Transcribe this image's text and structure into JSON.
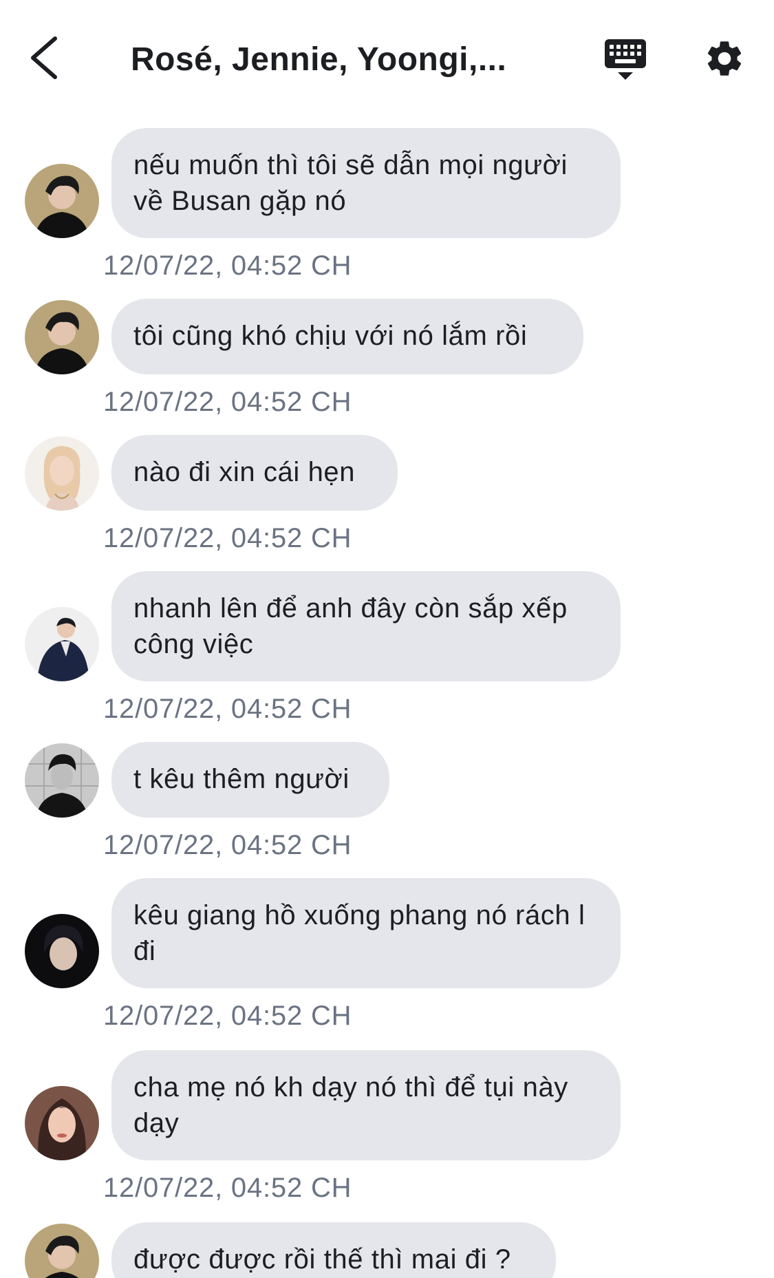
{
  "header": {
    "title": "Rosé, Jennie, Yoongi,...",
    "back_icon": "chevron-left-icon",
    "keyboard_icon": "keyboard-icon",
    "settings_icon": "gear-icon"
  },
  "colors": {
    "bubble": "#e4e6eb",
    "timestamp": "#6a7382",
    "text": "#1c1e21",
    "background": "#ffffff"
  },
  "messages": [
    {
      "text": "nếu muốn thì tôi sẽ dẫn mọi người về Busan gặp nó",
      "time": "12/07/22, 04:52 CH",
      "avatar": "avatar-man-dark-hair"
    },
    {
      "text": "tôi cũng khó chịu với nó lắm rồi",
      "time": "12/07/22, 04:52 CH",
      "avatar": "avatar-man-dark-hair"
    },
    {
      "text": "nào đi xin cái hẹn",
      "time": "12/07/22, 04:52 CH",
      "avatar": "avatar-blonde-woman"
    },
    {
      "text": "nhanh lên để anh đây còn sắp xếp công việc",
      "time": "12/07/22, 04:52 CH",
      "avatar": "avatar-man-suit"
    },
    {
      "text": "t kêu thêm người",
      "time": "12/07/22, 04:52 CH",
      "avatar": "avatar-man-monochrome"
    },
    {
      "text": "kêu giang hồ xuống phang nó rách l đi",
      "time": "12/07/22, 04:52 CH",
      "avatar": "avatar-man-dark"
    },
    {
      "text": "cha mẹ nó kh dạy nó thì để tụi này dạy",
      "time": "12/07/22, 04:52 CH",
      "avatar": "avatar-woman-dark-hair"
    },
    {
      "text": "được được rồi thế thì mai đi ?",
      "time": "",
      "avatar": "avatar-man-dark-hair"
    }
  ]
}
